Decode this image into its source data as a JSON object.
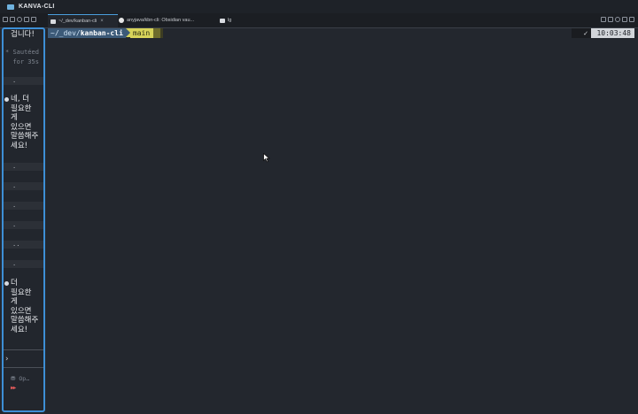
{
  "window": {
    "title": "KANVA-CLI",
    "accent_color": "#3d8fd6"
  },
  "tabs": [
    {
      "label": "~/_dev/kanban-cli",
      "close": "×",
      "icon": "terminal-icon",
      "active": true
    },
    {
      "label": "anyjava/kbn-cli: Obsidian vau...",
      "icon": "github-icon",
      "active": false
    },
    {
      "label": "lg",
      "icon": "terminal-icon",
      "active": false
    }
  ],
  "sidebar": {
    "top_text": "겁니다!",
    "sauteed": [
      "Sautéed",
      "for 35s"
    ],
    "message1": [
      "네, 더",
      "필요한",
      "게",
      "있으면",
      "말씀해주",
      "세요!"
    ],
    "dots": [
      ".",
      ".",
      ".",
      ".",
      ".",
      "..",
      "."
    ],
    "message2": [
      "더",
      "필요한",
      "게",
      "있으면",
      "말씀해주",
      "세요!"
    ],
    "chevron": "›",
    "status": "Op…",
    "arrows": "▶▶"
  },
  "terminal": {
    "path_prefix": "~/_dev/",
    "path_bold": "kanban-cli",
    "branch": "main",
    "status_check": "✓",
    "time": "10:03:48"
  }
}
